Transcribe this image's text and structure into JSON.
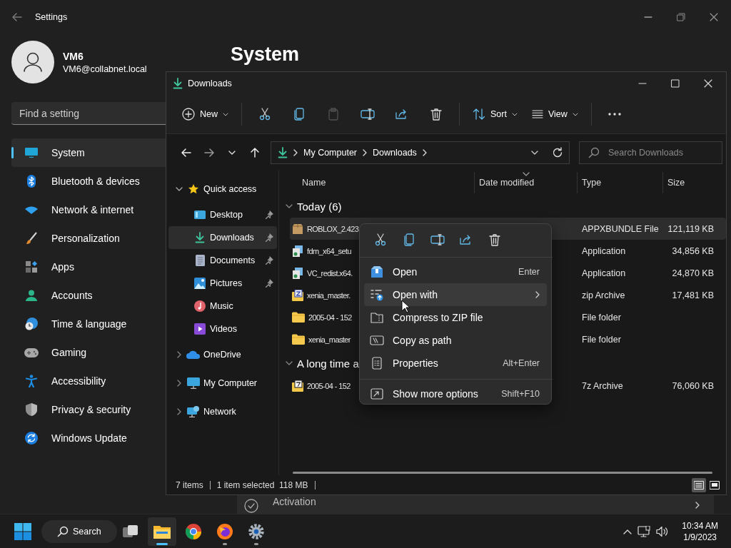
{
  "settings": {
    "title": "Settings",
    "user": {
      "name": "VM6",
      "email": "VM6@collabnet.local"
    },
    "search": {
      "placeholder": "Find a setting"
    },
    "nav": [
      {
        "label": "System",
        "selected": true
      },
      {
        "label": "Bluetooth & devices",
        "selected": false
      },
      {
        "label": "Network & internet",
        "selected": false
      },
      {
        "label": "Personalization",
        "selected": false
      },
      {
        "label": "Apps",
        "selected": false
      },
      {
        "label": "Accounts",
        "selected": false
      },
      {
        "label": "Time & language",
        "selected": false
      },
      {
        "label": "Gaming",
        "selected": false
      },
      {
        "label": "Accessibility",
        "selected": false
      },
      {
        "label": "Privacy & security",
        "selected": false
      },
      {
        "label": "Windows Update",
        "selected": false
      }
    ],
    "page_title": "System",
    "activation": {
      "label": "Activation"
    }
  },
  "explorer": {
    "title": "Downloads",
    "toolbar": [
      [
        {
          "kind": "new",
          "label": "New",
          "disabled": false
        }
      ],
      [
        {
          "kind": "cut",
          "disabled": false
        },
        {
          "kind": "copy",
          "disabled": false
        },
        {
          "kind": "paste",
          "disabled": true
        },
        {
          "kind": "rename",
          "disabled": false
        },
        {
          "kind": "share",
          "disabled": false
        },
        {
          "kind": "delete",
          "disabled": false
        }
      ],
      [
        {
          "kind": "sort",
          "label": "Sort",
          "disabled": false
        },
        {
          "kind": "view",
          "label": "View",
          "disabled": false
        }
      ],
      [
        {
          "kind": "more",
          "disabled": false
        }
      ]
    ],
    "breadcrumbs": [
      "My Computer",
      "Downloads"
    ],
    "search": {
      "placeholder": "Search Downloads"
    },
    "tree": [
      {
        "label": "Quick access",
        "expanded": true,
        "selected": false,
        "children": [
          {
            "label": "Desktop",
            "pinned": true,
            "selected": false
          },
          {
            "label": "Downloads",
            "pinned": true,
            "selected": true
          },
          {
            "label": "Documents",
            "pinned": true,
            "selected": false
          },
          {
            "label": "Pictures",
            "pinned": true,
            "selected": false
          },
          {
            "label": "Music",
            "pinned": false,
            "selected": false
          },
          {
            "label": "Videos",
            "pinned": false,
            "selected": false
          }
        ]
      },
      {
        "label": "OneDrive",
        "expanded": false,
        "selected": false
      },
      {
        "label": "My Computer",
        "expanded": false,
        "selected": false
      },
      {
        "label": "Network",
        "expanded": false,
        "selected": false
      }
    ],
    "columns": [
      {
        "label": "Name",
        "sorted": false
      },
      {
        "label": "Date modified",
        "sorted": true
      },
      {
        "label": "Type",
        "sorted": false
      },
      {
        "label": "Size",
        "sorted": false
      }
    ],
    "groups": [
      {
        "label": "Today (6)",
        "expanded": true,
        "rows": [
          {
            "name": "ROBLOX_2.423",
            "type": "APPXBUNDLE File",
            "size": "121,119 KB",
            "selected": true
          },
          {
            "name": "fdm_x64_setu",
            "type": "Application",
            "size": "34,856 KB",
            "selected": false
          },
          {
            "name": "VC_redist.x64.",
            "type": "Application",
            "size": "24,870 KB",
            "selected": false
          },
          {
            "name": "xenia_master.",
            "type": "zip Archive",
            "size": "17,481 KB",
            "selected": false
          },
          {
            "name": "2005-04 - 152",
            "type": "File folder",
            "selected": false
          },
          {
            "name": "xenia_master",
            "type": "File folder",
            "selected": false
          }
        ]
      },
      {
        "label": "A long time a",
        "expanded": true,
        "rows": [
          {
            "name": "2005-04 - 152",
            "type": "7z Archive",
            "size": "76,060 KB",
            "selected": false
          }
        ]
      }
    ],
    "status": {
      "count": "7 items",
      "selection": "1 item selected",
      "selection_size": "118 MB"
    },
    "view_modes": [
      {
        "kind": "details",
        "selected": true
      },
      {
        "kind": "tiles",
        "selected": false
      }
    ]
  },
  "context_menu": {
    "quick_actions": [
      {
        "kind": "cut"
      },
      {
        "kind": "copy"
      },
      {
        "kind": "rename"
      },
      {
        "kind": "share"
      },
      {
        "kind": "delete"
      }
    ],
    "groups": [
      [
        {
          "label": "Open",
          "shortcut": "Enter",
          "highlighted": false,
          "submenu": false
        },
        {
          "label": "Open with",
          "highlighted": true,
          "submenu": true
        },
        {
          "label": "Compress to ZIP file",
          "highlighted": false,
          "submenu": false
        },
        {
          "label": "Copy as path",
          "highlighted": false,
          "submenu": false
        },
        {
          "label": "Properties",
          "shortcut": "Alt+Enter",
          "highlighted": false,
          "submenu": false
        }
      ],
      [
        {
          "label": "Show more options",
          "shortcut": "Shift+F10",
          "highlighted": false,
          "submenu": false
        }
      ]
    ]
  },
  "taskbar": {
    "search_label": "Search",
    "apps": [
      {
        "kind": "taskview",
        "open": false,
        "selected": false
      },
      {
        "kind": "explorer",
        "open": true,
        "selected": true
      },
      {
        "kind": "chrome",
        "open": false,
        "selected": false
      },
      {
        "kind": "firefox",
        "open": true,
        "selected": false
      },
      {
        "kind": "settings",
        "open": true,
        "selected": false
      }
    ],
    "time": "10:34 AM",
    "date": "1/9/2023"
  }
}
